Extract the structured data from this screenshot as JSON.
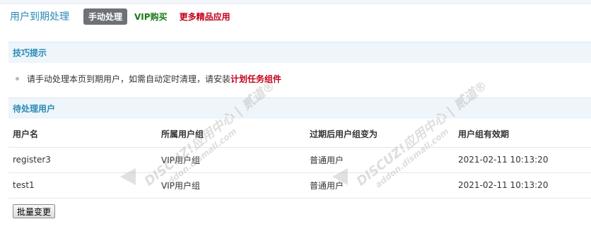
{
  "page": {
    "title": "用户到期处理",
    "tabs": [
      {
        "label": "手动处理",
        "active": true
      },
      {
        "label": "VIP购买"
      },
      {
        "label": "更多精品应用"
      }
    ]
  },
  "tips": {
    "heading": "技巧提示",
    "text": "请手动处理本页到期用户，如需自动定时清理，请安装",
    "link_label": "计划任务组件"
  },
  "pending": {
    "heading": "待处理用户",
    "columns": [
      "用户名",
      "所属用户组",
      "过期后用户组变为",
      "用户组有效期"
    ],
    "rows": [
      {
        "username": "register3",
        "group": "VIP用户组",
        "after": "普通用户",
        "expires": "2021-02-11 10:13:20"
      },
      {
        "username": "test1",
        "group": "VIP用户组",
        "after": "普通用户",
        "expires": "2021-02-11 10:13:20"
      }
    ],
    "batch_button": "批量变更"
  },
  "watermark": {
    "line1": "DISCUZ!应用中心 | 贰道®",
    "line2": "addon.dismall.com"
  },
  "colors": {
    "title_blue": "#2a8bb5",
    "accent_red": "#c4001a",
    "vip_green": "#1a7a1a",
    "tab_active_bg": "#6e7176",
    "section_bg": "#eef5fb"
  }
}
